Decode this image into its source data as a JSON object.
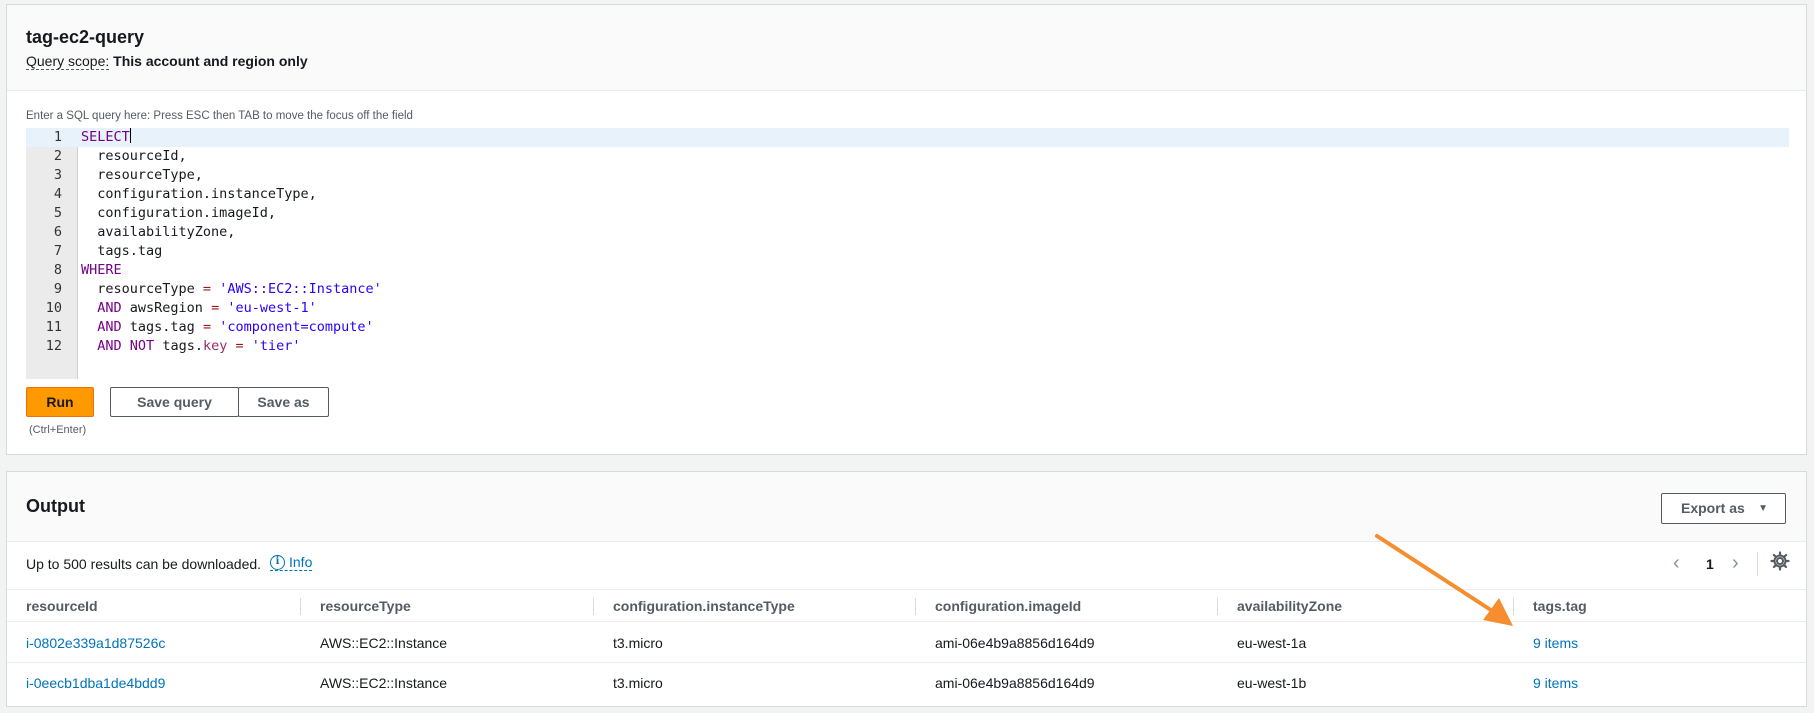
{
  "query": {
    "title": "tag-ec2-query",
    "scope_label": "Query scope:",
    "scope_value": "This account and region only",
    "editor_hint": "Enter a SQL query here: Press ESC then TAB to move the focus off the field",
    "lines": [
      {
        "n": "1",
        "code": "SELECT"
      },
      {
        "n": "2",
        "code": "  resourceId,"
      },
      {
        "n": "3",
        "code": "  resourceType,"
      },
      {
        "n": "4",
        "code": "  configuration.instanceType,"
      },
      {
        "n": "5",
        "code": "  configuration.imageId,"
      },
      {
        "n": "6",
        "code": "  availabilityZone,"
      },
      {
        "n": "7",
        "code": "  tags.tag"
      },
      {
        "n": "8",
        "code": "WHERE"
      },
      {
        "n": "9",
        "code": "  resourceType = 'AWS::EC2::Instance'"
      },
      {
        "n": "10",
        "code": "  AND awsRegion = 'eu-west-1'"
      },
      {
        "n": "11",
        "code": "  AND tags.tag = 'component=compute'"
      },
      {
        "n": "12",
        "code": "  AND NOT tags.key = 'tier'"
      }
    ],
    "run_label": "Run",
    "save_query_label": "Save query",
    "save_as_label": "Save as",
    "run_hint": "(Ctrl+Enter)"
  },
  "output": {
    "title": "Output",
    "export_label": "Export as",
    "download_note": "Up to 500 results can be downloaded.",
    "info_label": "Info",
    "page": "1",
    "columns": [
      "resourceId",
      "resourceType",
      "configuration.instanceType",
      "configuration.imageId",
      "availabilityZone",
      "tags.tag"
    ],
    "rows": [
      [
        "i-0802e339a1d87526c",
        "AWS::EC2::Instance",
        "t3.micro",
        "ami-06e4b9a8856d164d9",
        "eu-west-1a",
        "9 items"
      ],
      [
        "i-0eecb1dba1de4bdd9",
        "AWS::EC2::Instance",
        "t3.micro",
        "ami-06e4b9a8856d164d9",
        "eu-west-1b",
        "9 items"
      ]
    ]
  },
  "colors": {
    "accent": "#ff9900",
    "link": "#0073bb",
    "annotation_arrow": "#f68d2e"
  },
  "icons": [
    "caret-down-icon",
    "info-icon",
    "chevron-left-icon",
    "chevron-right-icon",
    "gear-icon"
  ]
}
